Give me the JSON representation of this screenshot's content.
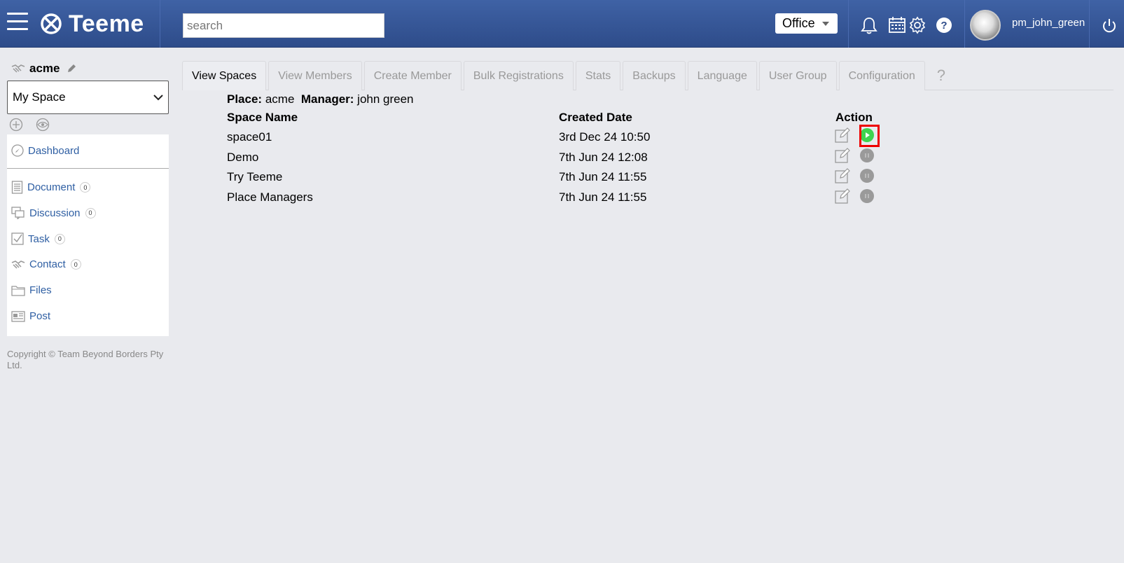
{
  "header": {
    "logo_text": "Teeme",
    "search_placeholder": "search",
    "office_label": "Office",
    "username": "pm_john_green",
    "colors": {
      "bar": "#3f62a5",
      "play": "#3fd34f"
    }
  },
  "sidebar": {
    "place_name": "acme",
    "space_select": "My Space",
    "items": [
      {
        "label": "Dashboard",
        "icon": "compass-icon"
      },
      {
        "label": "Document",
        "count": "0",
        "icon": "document-icon"
      },
      {
        "label": "Discussion",
        "count": "0",
        "icon": "discussion-icon"
      },
      {
        "label": "Task",
        "count": "0",
        "icon": "task-check-icon"
      },
      {
        "label": "Contact",
        "count": "0",
        "icon": "handshake-icon"
      },
      {
        "label": "Files",
        "icon": "folder-icon"
      },
      {
        "label": "Post",
        "icon": "post-icon"
      }
    ],
    "copyright": "Copyright © Team Beyond Borders Pty Ltd."
  },
  "tabs": [
    {
      "label": "View Spaces",
      "active": true
    },
    {
      "label": "View Members"
    },
    {
      "label": "Create Member"
    },
    {
      "label": "Bulk Registrations"
    },
    {
      "label": "Stats"
    },
    {
      "label": "Backups"
    },
    {
      "label": "Language"
    },
    {
      "label": "User Group"
    },
    {
      "label": "Configuration"
    }
  ],
  "tab_help": "?",
  "content": {
    "place_label": "Place:",
    "place_value": "acme",
    "manager_label": "Manager:",
    "manager_value": "john green",
    "columns": {
      "name": "Space Name",
      "created": "Created Date",
      "action": "Action"
    },
    "rows": [
      {
        "name": "space01",
        "created": "3rd Dec 24 10:50",
        "status": "play"
      },
      {
        "name": "Demo",
        "created": "7th Jun 24 12:08",
        "status": "pause"
      },
      {
        "name": "Try Teeme",
        "created": "7th Jun 24 11:55",
        "status": "pause"
      },
      {
        "name": "Place Managers",
        "created": "7th Jun 24 11:55",
        "status": "pause"
      }
    ]
  }
}
